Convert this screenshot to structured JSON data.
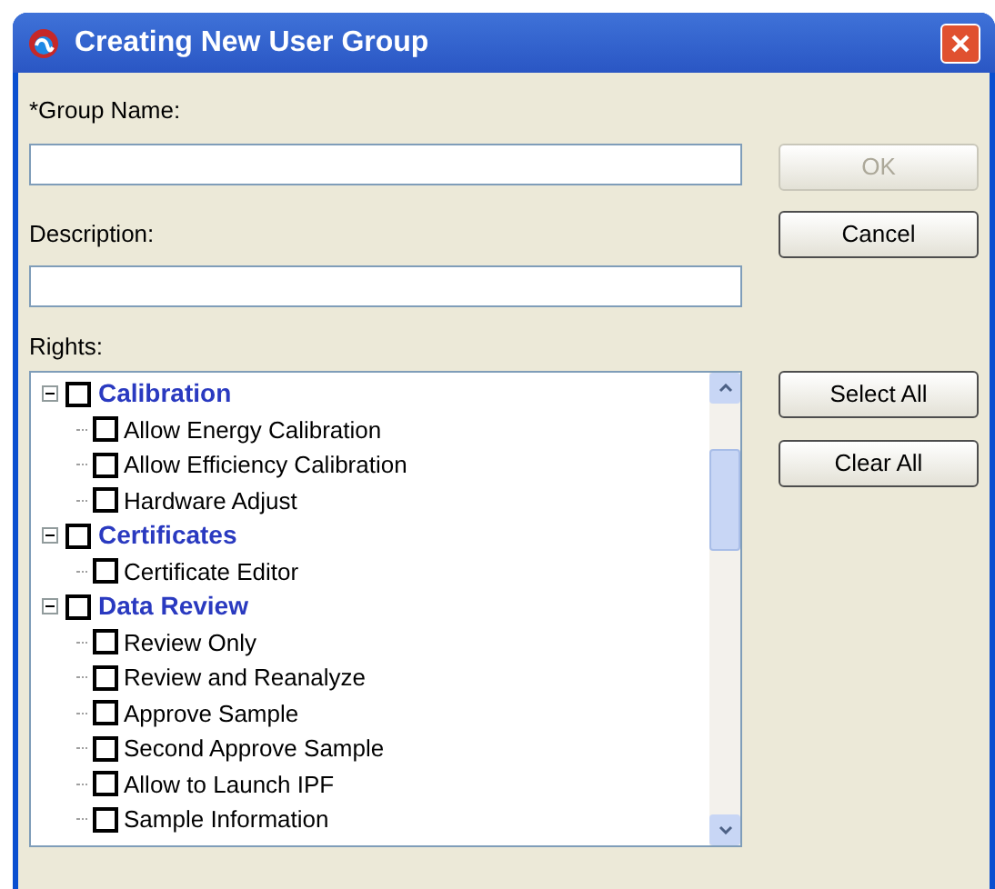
{
  "window": {
    "title": "Creating New User Group"
  },
  "group_name": {
    "label": "*Group Name:"
  },
  "description": {
    "label": "Description:"
  },
  "rights": {
    "label": "Rights:",
    "groups": [
      {
        "label": "Calibration",
        "expanded": true,
        "checked": false,
        "children": [
          {
            "label": "Allow Energy Calibration",
            "checked": false
          },
          {
            "label": "Allow Efficiency Calibration",
            "checked": false
          },
          {
            "label": "Hardware Adjust",
            "checked": false
          }
        ]
      },
      {
        "label": "Certificates",
        "expanded": true,
        "checked": false,
        "children": [
          {
            "label": "Certificate Editor",
            "checked": false
          }
        ]
      },
      {
        "label": "Data Review",
        "expanded": true,
        "checked": false,
        "children": [
          {
            "label": "Review Only",
            "checked": false
          },
          {
            "label": "Review and Reanalyze",
            "checked": false
          },
          {
            "label": "Approve Sample",
            "checked": false
          },
          {
            "label": "Second Approve Sample",
            "checked": false
          },
          {
            "label": "Allow to Launch IPF",
            "checked": false
          },
          {
            "label": "Sample Information",
            "checked": false
          }
        ]
      }
    ]
  },
  "buttons": [
    {
      "label": "OK",
      "disabled": true
    },
    {
      "label": "Cancel",
      "disabled": false
    }
  ],
  "tree_buttons": [
    {
      "label": "Select All",
      "disabled": false
    },
    {
      "label": "Clear All",
      "disabled": false
    }
  ]
}
